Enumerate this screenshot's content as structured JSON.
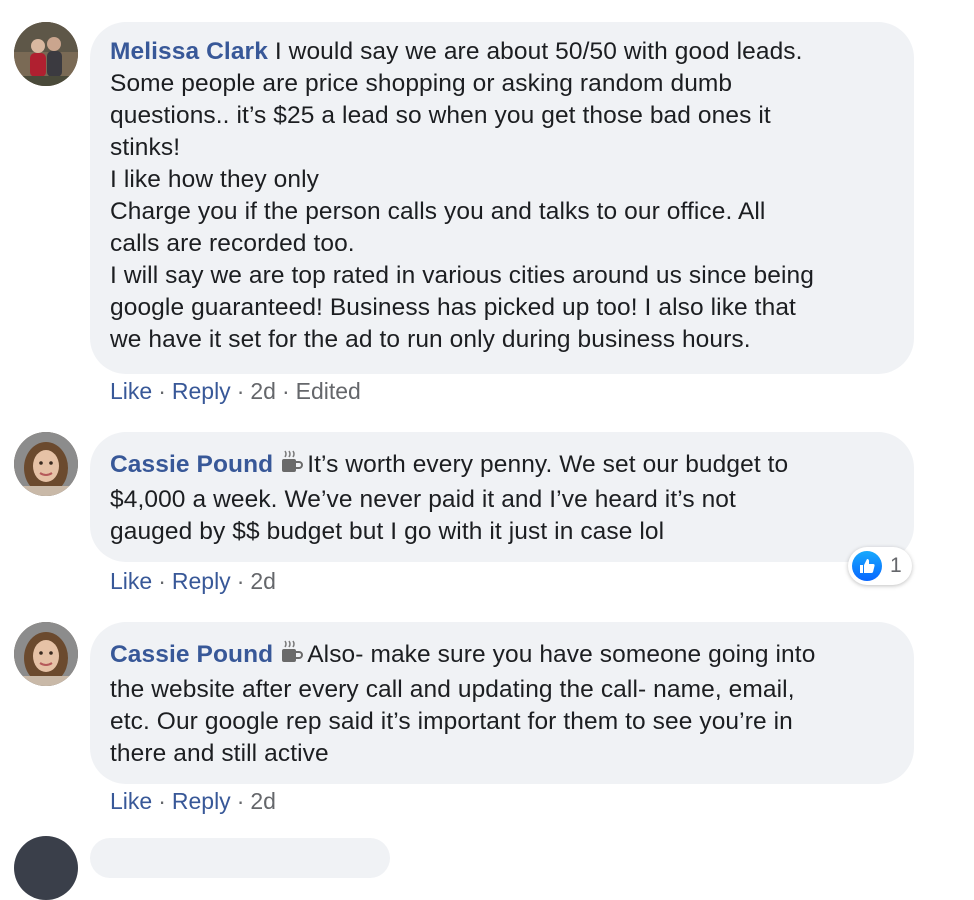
{
  "comments": [
    {
      "author": "Melissa Clark",
      "lines": [
        "I would say we are about 50/50 with good leads.",
        "Some people are price shopping or asking random dumb",
        "questions.. it’s $25 a lead so when you get those bad ones it",
        "stinks!",
        "I like how they only",
        "Charge you if the person calls you and talks to our office. All",
        "calls are recorded too.",
        "I will say we are top rated in various cities around us since being",
        "google guaranteed! Business has picked up too! I also like that",
        "we have it set for the ad to run only during business hours."
      ],
      "actions": {
        "like": "Like",
        "reply": "Reply",
        "time": "2d",
        "edited": "Edited"
      }
    },
    {
      "author": "Cassie Pound",
      "badge_icon": "coffee-cup-icon",
      "lines": [
        "It’s worth every penny. We set our budget to",
        "$4,000 a week. We’ve never paid it and I’ve heard it’s not",
        "gauged by $$ budget but I go with it just in case lol"
      ],
      "actions": {
        "like": "Like",
        "reply": "Reply",
        "time": "2d"
      },
      "reactions": {
        "icon": "like-reaction-icon",
        "count": "1"
      }
    },
    {
      "author": "Cassie Pound",
      "badge_icon": "coffee-cup-icon",
      "lines": [
        "Also- make sure you have someone going into",
        "the website after every call and updating the call- name, email,",
        "etc. Our google rep said it’s important for them to see you’re in",
        "there and still active"
      ],
      "actions": {
        "like": "Like",
        "reply": "Reply",
        "time": "2d"
      }
    }
  ],
  "colors": {
    "author": "#385898",
    "meta": "#65676b",
    "bubble": "#f0f2f5",
    "like": "#0866ff"
  }
}
